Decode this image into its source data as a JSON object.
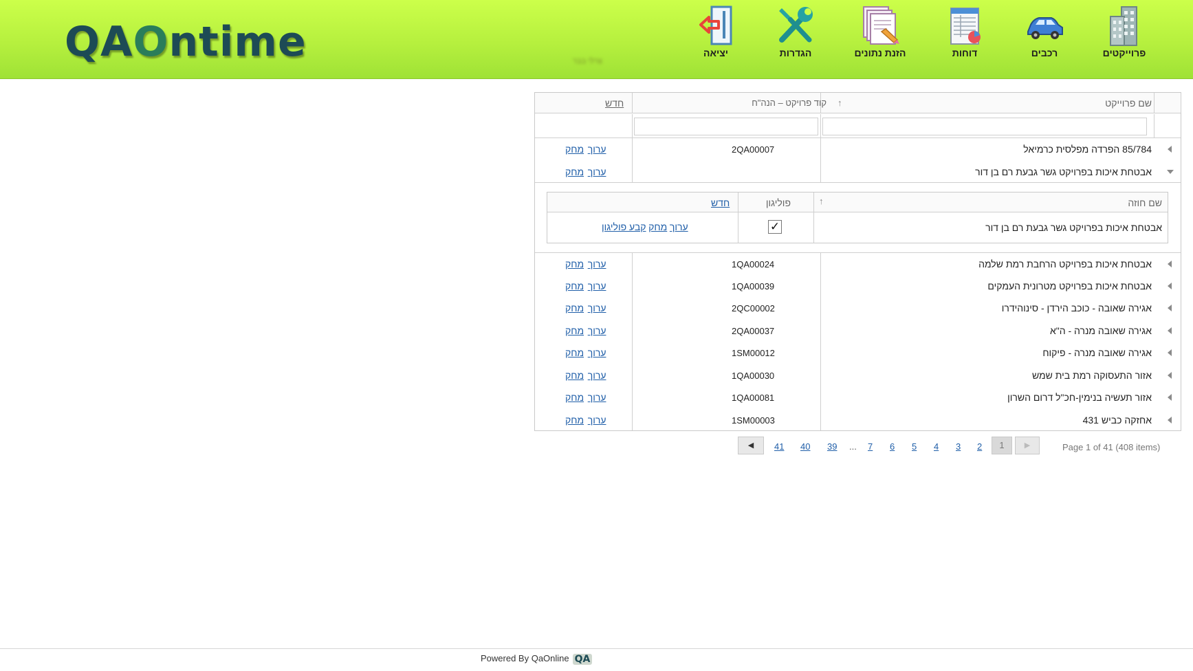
{
  "header": {
    "logo": "QAOntime",
    "user_name": "צרלי בבר",
    "nav": [
      {
        "label": "פרוייקטים",
        "icon": "buildings-icon"
      },
      {
        "label": "רכבים",
        "icon": "car-icon"
      },
      {
        "label": "דוחות",
        "icon": "report-icon"
      },
      {
        "label": "הזנת נתונים",
        "icon": "data-entry-icon"
      },
      {
        "label": "הגדרות",
        "icon": "tools-icon"
      },
      {
        "label": "יציאה",
        "icon": "exit-icon"
      }
    ]
  },
  "grid": {
    "col_name": "שם פרוייקט",
    "col_code": "קוד פרויקט – הנה\"ח",
    "new_label": "חדש",
    "edit_label": "ערוך",
    "delete_label": "מחק",
    "rows": [
      {
        "name": "85/784 הפרדה מפלסית כרמיאל",
        "code": "2QA00007"
      },
      {
        "name": "אבטחת איכות בפרויקט גשר גבעת רם בן דור",
        "code": ""
      },
      {
        "name": "אבטחת איכות בפרויקט הרחבת רמת שלמה",
        "code": "1QA00024"
      },
      {
        "name": "אבטחת איכות בפרויקט מטרונית העמקים",
        "code": "1QA00039"
      },
      {
        "name": "אגירה שאובה - כוכב הירדן - סינוהידרו",
        "code": "2QC00002"
      },
      {
        "name": "אגירה שאובה מנרה - ה\"א",
        "code": "2QA00037"
      },
      {
        "name": "אגירה שאובה מנרה - פיקוח",
        "code": "1SM00012"
      },
      {
        "name": "אזור התעסוקה רמת בית שמש",
        "code": "1QA00030"
      },
      {
        "name": "אזור תעשיה בנימין-חכ\"ל דרום השרון",
        "code": "1QA00081"
      },
      {
        "name": "אחזקה כביש 431",
        "code": "1SM00003"
      }
    ],
    "detail": {
      "col_contract": "שם חוזה",
      "col_polygon": "פוליגון",
      "new_label": "חדש",
      "row": {
        "contract": "אבטחת איכות בפרויקט גשר גבעת רם בן דור",
        "polygon_checked": true,
        "edit_label": "ערוך",
        "delete_label": "מחק",
        "set_polygon_label": "קבע פוליגון"
      }
    }
  },
  "pager": {
    "pages": [
      "41",
      "40",
      "39",
      "...",
      "7",
      "6",
      "5",
      "4",
      "3",
      "2",
      "1"
    ],
    "current": "1",
    "info": "Page 1 of 41 (408 items)"
  },
  "footer": {
    "text": "Powered By QaOnline",
    "logo": "QA"
  }
}
